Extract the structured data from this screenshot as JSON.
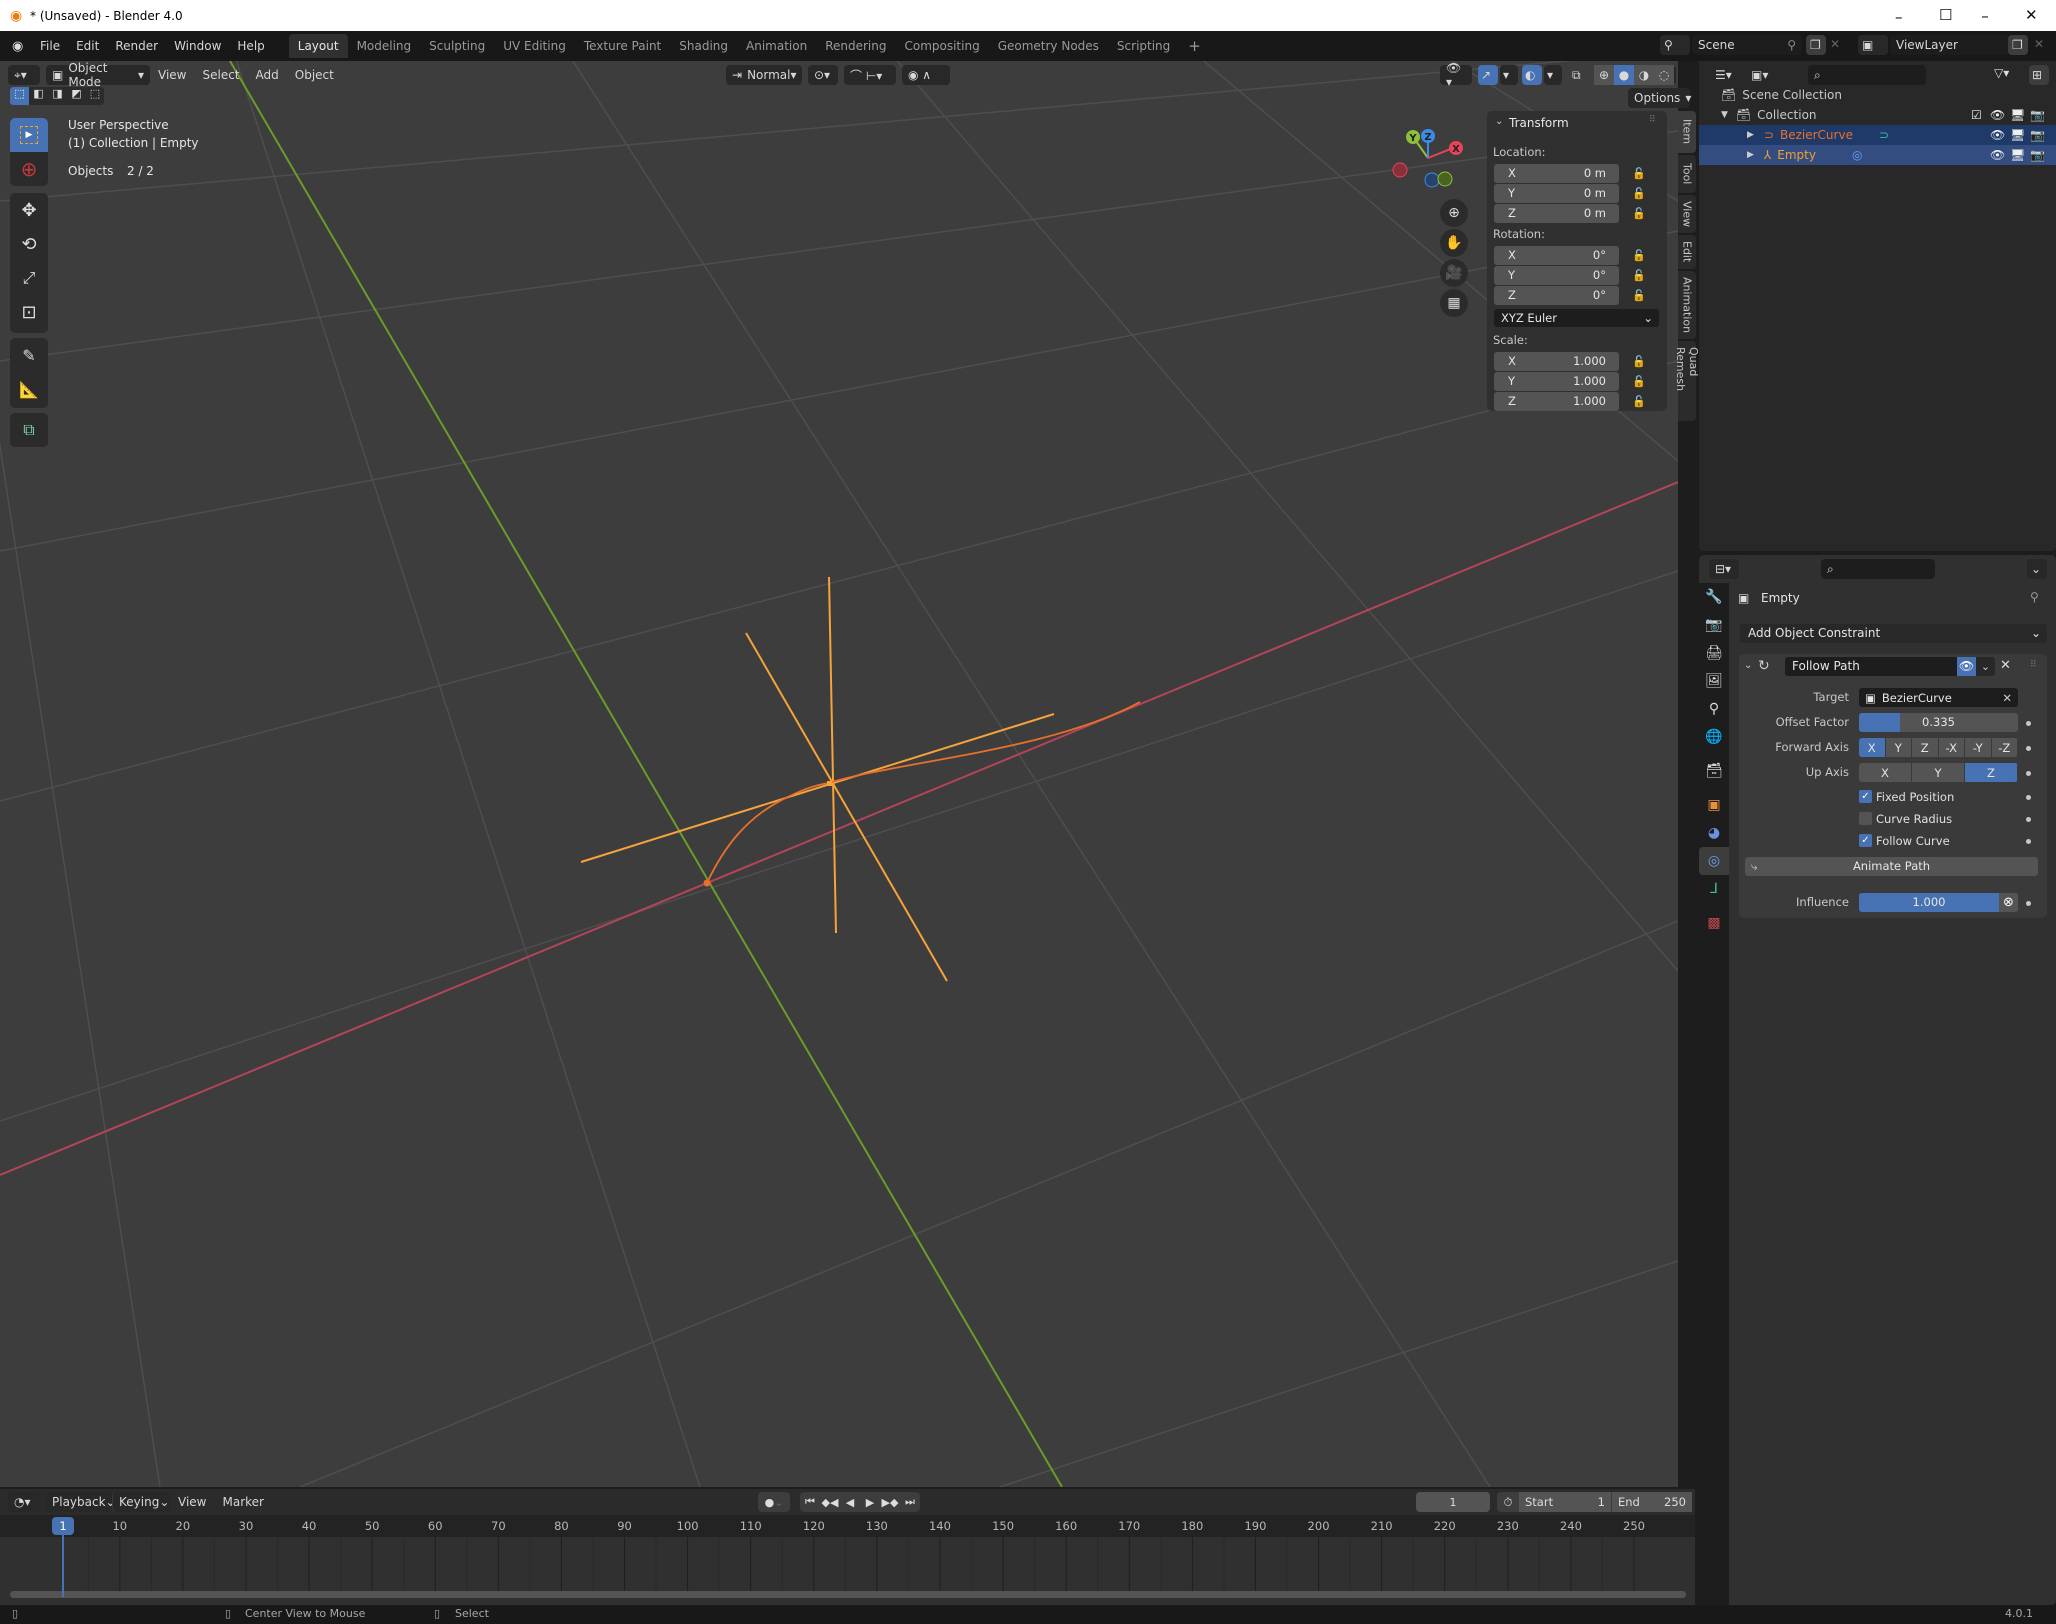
{
  "window": {
    "title": "* (Unsaved) - Blender 4.0",
    "minimize": "–",
    "maximize": "☐",
    "close": "✕"
  },
  "menu": {
    "items": [
      "File",
      "Edit",
      "Render",
      "Window",
      "Help"
    ]
  },
  "workspaces": [
    "Layout",
    "Modeling",
    "Sculpting",
    "UV Editing",
    "Texture Paint",
    "Shading",
    "Animation",
    "Rendering",
    "Compositing",
    "Geometry Nodes",
    "Scripting"
  ],
  "active_workspace": "Layout",
  "add_workspace": "+",
  "scene": {
    "label": "Scene",
    "view_layer": "ViewLayer"
  },
  "viewport_header": {
    "mode": "Object Mode",
    "menus": [
      "View",
      "Select",
      "Add",
      "Object"
    ],
    "orientation": "Normal",
    "options": "Options"
  },
  "viewport_overlay": {
    "perspective": "User Perspective",
    "collection_info": "(1) Collection | Empty",
    "objects_label": "Objects",
    "objects_count": "2 / 2"
  },
  "gizmo": {
    "x": "X",
    "y": "Y",
    "z": "Z"
  },
  "transform_panel": {
    "title": "Transform",
    "location_label": "Location:",
    "location": [
      {
        "axis": "X",
        "value": "0 m"
      },
      {
        "axis": "Y",
        "value": "0 m"
      },
      {
        "axis": "Z",
        "value": "0 m"
      }
    ],
    "rotation_label": "Rotation:",
    "rotation": [
      {
        "axis": "X",
        "value": "0°"
      },
      {
        "axis": "Y",
        "value": "0°"
      },
      {
        "axis": "Z",
        "value": "0°"
      }
    ],
    "rotation_mode": "XYZ Euler",
    "scale_label": "Scale:",
    "scale": [
      {
        "axis": "X",
        "value": "1.000"
      },
      {
        "axis": "Y",
        "value": "1.000"
      },
      {
        "axis": "Z",
        "value": "1.000"
      }
    ]
  },
  "sidebar_tabs": [
    "Item",
    "Tool",
    "View",
    "Edit",
    "Animation",
    "Quad Remesh"
  ],
  "outliner": {
    "scene_collection": "Scene Collection",
    "collection": "Collection",
    "items": [
      {
        "name": "BezierCurve",
        "color": "#e8702a"
      },
      {
        "name": "Empty",
        "color": "#f0a030"
      }
    ]
  },
  "properties": {
    "object_name": "Empty",
    "add_constraint": "Add Object Constraint",
    "constraint": {
      "name": "Follow Path",
      "target_label": "Target",
      "target": "BezierCurve",
      "offset_label": "Offset Factor",
      "offset_value": "0.335",
      "offset_fraction": 0.335,
      "forward_axis_label": "Forward Axis",
      "forward_axis": [
        "X",
        "Y",
        "Z",
        "-X",
        "-Y",
        "-Z"
      ],
      "forward_axis_selected": "X",
      "up_axis_label": "Up Axis",
      "up_axis": [
        "X",
        "Y",
        "Z"
      ],
      "up_axis_selected": "Z",
      "fixed_position": {
        "label": "Fixed Position",
        "checked": true
      },
      "curve_radius": {
        "label": "Curve Radius",
        "checked": false
      },
      "follow_curve": {
        "label": "Follow Curve",
        "checked": true
      },
      "animate_path": "Animate Path",
      "influence_label": "Influence",
      "influence_value": "1.000",
      "influence_fraction": 1.0
    }
  },
  "timeline": {
    "menus": [
      "Playback",
      "Keying",
      "View",
      "Marker"
    ],
    "current_frame": "1",
    "start_label": "Start",
    "start": "1",
    "end_label": "End",
    "end": "250",
    "ticks": [
      "10",
      "20",
      "30",
      "40",
      "50",
      "60",
      "70",
      "80",
      "90",
      "100",
      "110",
      "120",
      "130",
      "140",
      "150",
      "160",
      "170",
      "180",
      "190",
      "200",
      "210",
      "220",
      "230",
      "240",
      "250"
    ],
    "playhead": "1"
  },
  "statusbar": {
    "hint1": "Center View to Mouse",
    "hint2": "Select",
    "version": "4.0.1"
  }
}
